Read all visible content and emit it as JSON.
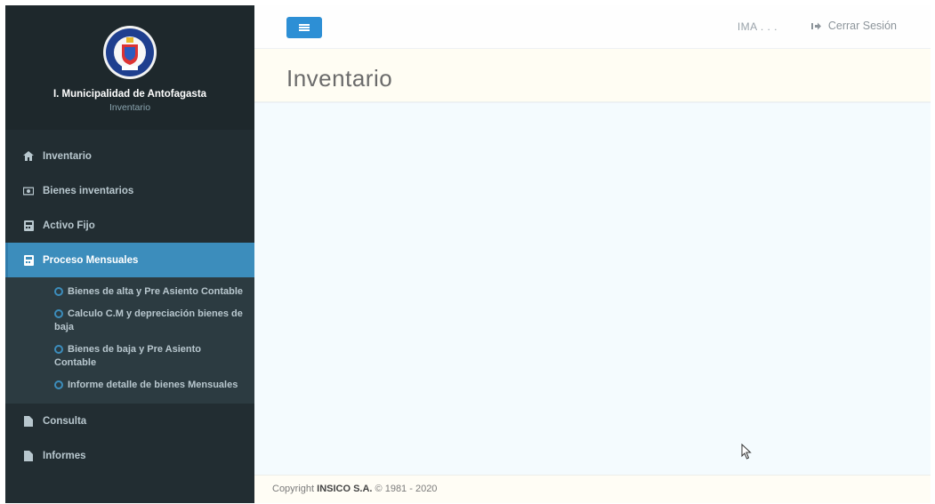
{
  "sidebar": {
    "org_name": "I. Municipalidad de Antofagasta",
    "org_sub": "Inventario",
    "logo": "antofagasta-seal",
    "menu": [
      {
        "label": "Inventario",
        "icon": "home-icon"
      },
      {
        "label": "Bienes inventarios",
        "icon": "money-icon"
      },
      {
        "label": "Activo Fijo",
        "icon": "calculator-icon"
      },
      {
        "label": "Proceso Mensuales",
        "icon": "calculator-icon",
        "active": true
      }
    ],
    "submenu": [
      {
        "label": "Bienes de alta y Pre Asiento Contable"
      },
      {
        "label": "Calculo C.M y depreciación bienes de baja"
      },
      {
        "label": "Bienes de baja y Pre Asiento Contable"
      },
      {
        "label": "Informe detalle de bienes Mensuales"
      }
    ],
    "menu_bottom": [
      {
        "label": "Consulta",
        "icon": "file-icon"
      },
      {
        "label": "Informes",
        "icon": "file-icon"
      }
    ]
  },
  "topbar": {
    "user": "IMA . . .",
    "logout_label": "Cerrar Sesión"
  },
  "page": {
    "title": "Inventario"
  },
  "footer": {
    "prefix": "Copyright",
    "company": "INSICO S.A.",
    "suffix": "© 1981 - 2020"
  },
  "colors": {
    "sidebar": "#222d32",
    "active": "#3c8dbc",
    "toggle": "#2d8fd5"
  }
}
